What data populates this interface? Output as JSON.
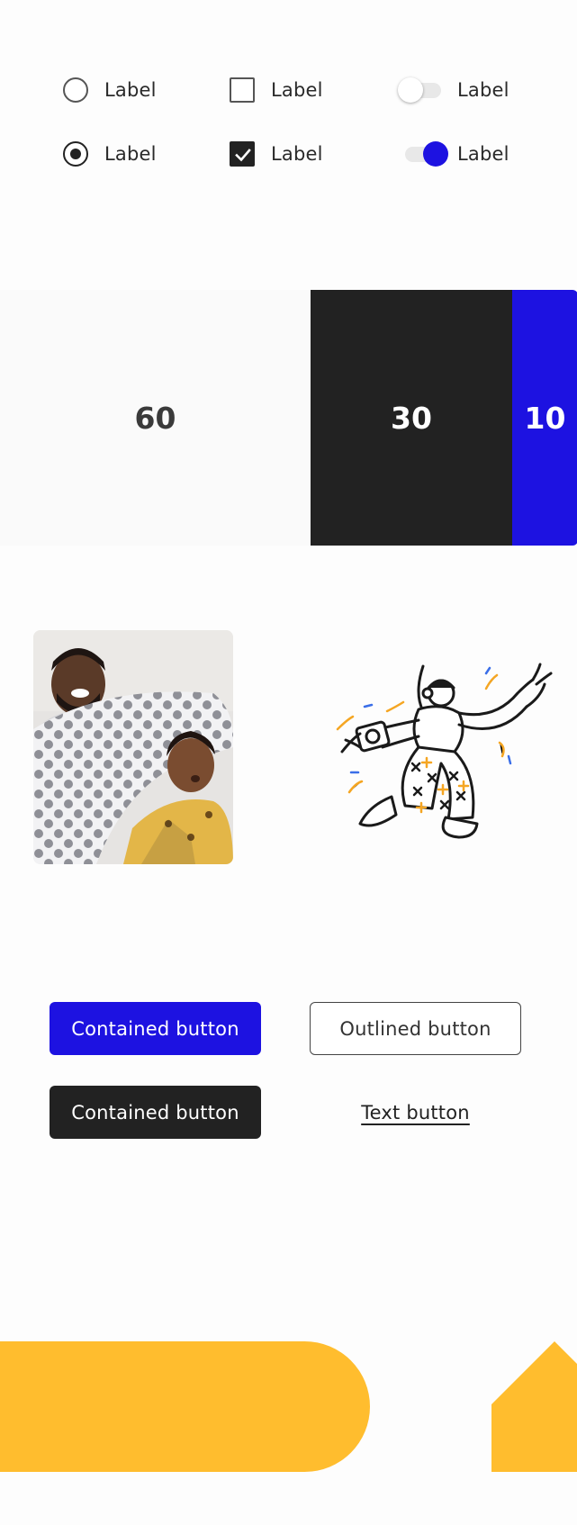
{
  "controls": {
    "radio_off_label": "Label",
    "radio_on_label": "Label",
    "checkbox_off_label": "Label",
    "checkbox_on_label": "Label",
    "toggle_off_label": "Label",
    "toggle_on_label": "Label"
  },
  "ratio": {
    "primary": "60",
    "secondary": "30",
    "accent": "10"
  },
  "buttons": {
    "contained_primary": "Contained button",
    "outlined": "Outlined button",
    "contained_dark": "Contained button",
    "text": "Text button"
  },
  "colors": {
    "primary": "#1d12e1",
    "dark": "#222222",
    "yellow": "#ffbd2e",
    "orange": "#f5a623"
  }
}
